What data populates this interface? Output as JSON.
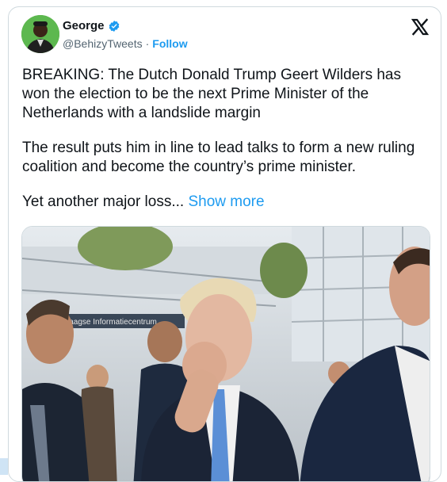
{
  "user": {
    "display_name": "George",
    "handle": "@BehizyTweets",
    "separator": "·",
    "follow_label": "Follow"
  },
  "tweet": {
    "paragraph1": "BREAKING: The Dutch Donald Trump Geert Wilders has won the election to be the next Prime Minister of the Netherlands with a landslide margin",
    "paragraph2": "The result puts him in line to lead talks to form a new ruling coalition and become the country’s prime minister.",
    "paragraph3": "Yet another major loss...",
    "show_more": "Show more"
  },
  "photo": {
    "banner_text": "Haagse Informatiecentrum"
  },
  "icons": {
    "verified": "verified-badge-icon",
    "x_logo": "x-logo-icon"
  },
  "colors": {
    "link": "#1d9bf0",
    "text": "#0f1419",
    "secondary": "#536471",
    "border": "#cfd9de"
  }
}
